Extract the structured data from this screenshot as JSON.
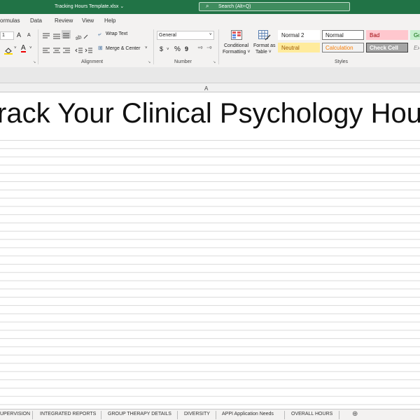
{
  "title_bar": {
    "file_name": "Tracking Hours Template.xlsx",
    "chevron": "⌄",
    "search_icon": "⌕",
    "search_placeholder": "Search (Alt+Q)"
  },
  "menu": [
    "ormulas",
    "Data",
    "Review",
    "View",
    "Help"
  ],
  "ribbon": {
    "font": {
      "size": "1",
      "grow": "A",
      "shrink": "A",
      "fill_icon": "paint-bucket-icon",
      "font_color_letter": "A"
    },
    "alignment": {
      "wrap_text": "Wrap Text",
      "merge_center": "Merge & Center",
      "label": "Alignment"
    },
    "number": {
      "format": "General",
      "currency": "$",
      "percent": "%",
      "comma": "9",
      "inc_dec": "⁺⁰",
      "dec_dec": "⁻⁰",
      "label": "Number"
    },
    "conditional_formatting": [
      "Conditional",
      "Formatting ˅"
    ],
    "format_as_table": [
      "Format as",
      "Table ˅"
    ],
    "styles": {
      "label": "Styles",
      "items": [
        {
          "label": "Normal 2",
          "bg": "#ffffff",
          "fg": "#222222",
          "border": "#ffffff"
        },
        {
          "label": "Normal",
          "bg": "#ffffff",
          "fg": "#222222",
          "border": "#767676"
        },
        {
          "label": "Bad",
          "bg": "#ffc7ce",
          "fg": "#9c0006",
          "border": "#ffc7ce"
        },
        {
          "label": "Goo",
          "bg": "#c6efce",
          "fg": "#006100",
          "border": "#c6efce"
        },
        {
          "label": "Neutral",
          "bg": "#ffeb9c",
          "fg": "#9c5700",
          "border": "#ffeb9c"
        },
        {
          "label": "Calculation",
          "bg": "#f2f2f2",
          "fg": "#fa7d00",
          "border": "#7f7f7f"
        },
        {
          "label": "Check Cell",
          "bg": "#a5a5a5",
          "fg": "#ffffff",
          "border": "#3f3f3f"
        },
        {
          "label": "Expl",
          "bg": "#f3f2f1",
          "fg": "#7f7f7f",
          "border": "#f3f2f1"
        }
      ]
    }
  },
  "sheet": {
    "column_a": "A",
    "title": "rack Your Clinical Psychology Hours"
  },
  "tabs": [
    "UPERVISION",
    "INTEGRATED REPORTS",
    "GROUP THERAPY DETAILS",
    "DIVERSITY",
    "APPI Application Needs",
    "OVERALL HOURS"
  ],
  "add_sheet": "⊕",
  "colors": {
    "brand_green": "#217346",
    "ribbon_bg": "#f3f2f1"
  }
}
